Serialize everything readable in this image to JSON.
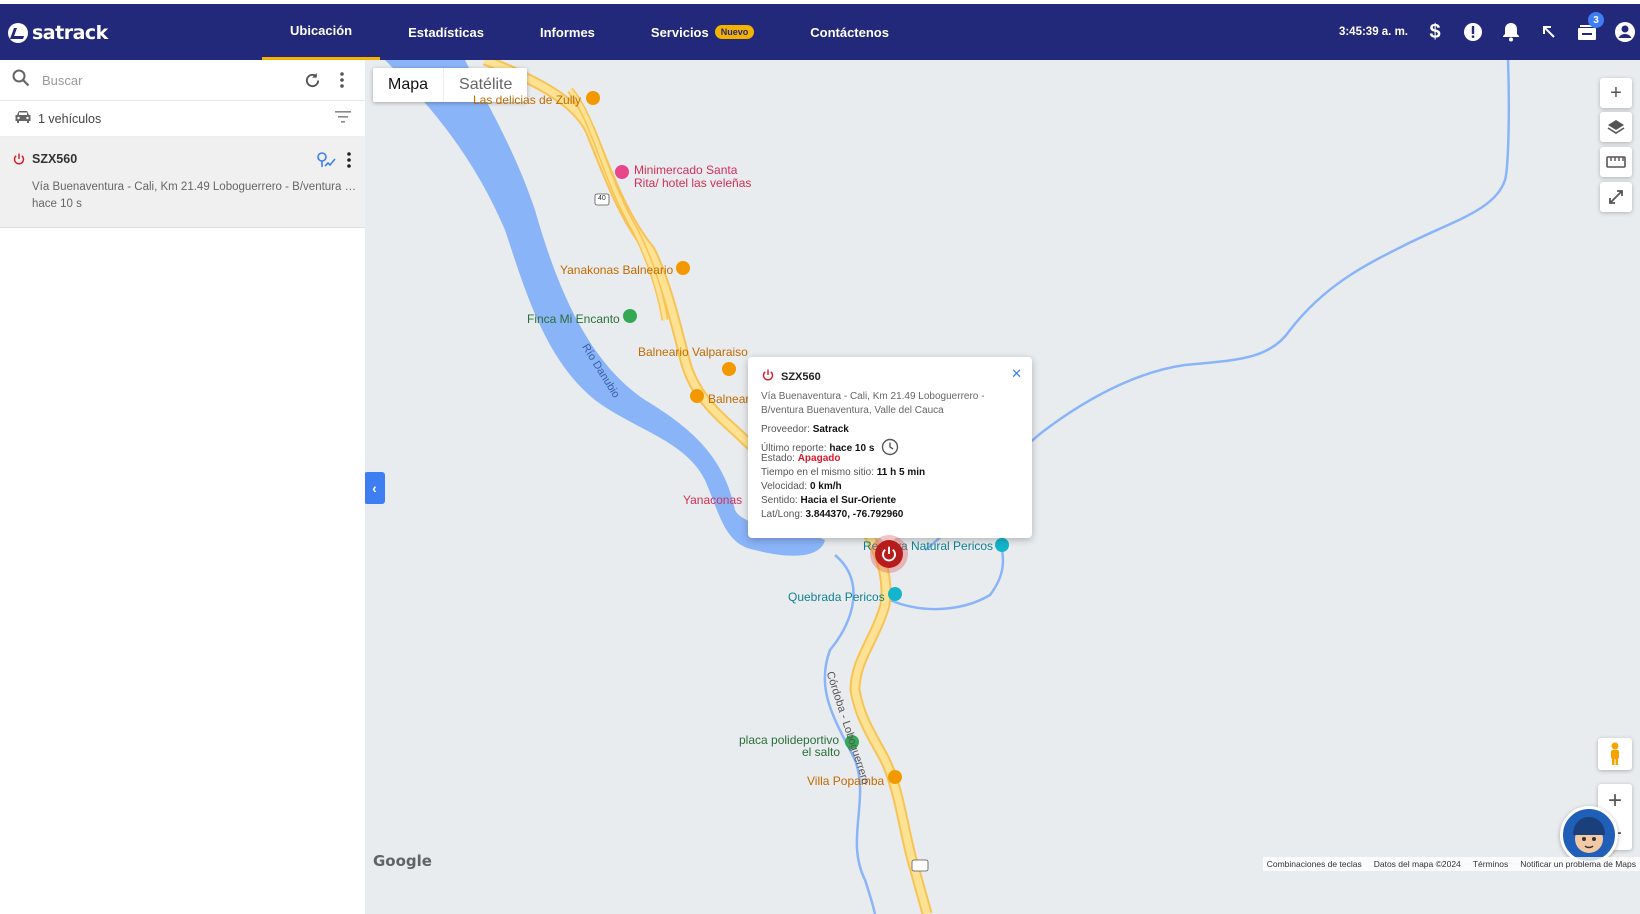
{
  "header": {
    "logo_text": "satrack",
    "nav": [
      {
        "label": "Ubicación"
      },
      {
        "label": "Estadísticas"
      },
      {
        "label": "Informes"
      },
      {
        "label": "Servicios",
        "badge": "Nuevo"
      },
      {
        "label": "Contáctenos"
      }
    ],
    "clock": "3:45:39 a. m.",
    "inbox_count": "3",
    "accent_color": "#f5b301",
    "bar_color": "#23297a"
  },
  "sidebar": {
    "search_placeholder": "Buscar",
    "vehicle_count": "1 vehículos",
    "vehicles": [
      {
        "plate": "SZX560",
        "address": "Vía Buenaventura - Cali, Km 21.49 Loboguerrero - B/ventura Buenaventura, Valle del Cauca",
        "time_ago": "hace 10 s"
      }
    ]
  },
  "map": {
    "type_map": "Mapa",
    "type_satellite": "Satélite",
    "pois": [
      {
        "label": "Las delicias de Zully"
      },
      {
        "label": "Minimercado Santa"
      },
      {
        "label": "Rita/ hotel las veleñas"
      },
      {
        "label": "Yanakonas Balneario"
      },
      {
        "label": "Finca Mi Encanto"
      },
      {
        "label": "Balneario Valparaiso"
      },
      {
        "label": "Balnear"
      },
      {
        "label": "Yanaconas"
      },
      {
        "label": "Reserva Natural Pericos"
      },
      {
        "label": "Quebrada Pericos"
      },
      {
        "label": "placa polideportivo"
      },
      {
        "label": "el salto"
      },
      {
        "label": "Villa Popamba"
      }
    ],
    "river_label": "Río Danubio",
    "road_label": "Córdoba - Loboguerrero",
    "route_shield": "40",
    "google": "Google",
    "attribution": [
      "Combinaciones de teclas",
      "Datos del mapa ©2024",
      "Términos",
      "Notificar un problema de Maps"
    ]
  },
  "popup": {
    "plate": "SZX560",
    "address": "Vía Buenaventura - Cali, Km 21.49 Loboguerrero - B/ventura Buenaventura, Valle del Cauca",
    "provider_label": "Proveedor:",
    "provider": "Satrack",
    "last_report_label": "Último reporte:",
    "last_report": "hace 10 s",
    "status_label": "Estado:",
    "status": "Apagado",
    "status_color": "#d8192a",
    "same_place_label": "Tiempo en el mismo sitio:",
    "same_place": "11 h 5 min",
    "speed_label": "Velocidad:",
    "speed": "0 km/h",
    "direction_label": "Sentido:",
    "direction": "Hacia el Sur-Oriente",
    "latlong_label": "Lat/Long:",
    "latlong": "3.844370, -76.792960"
  }
}
